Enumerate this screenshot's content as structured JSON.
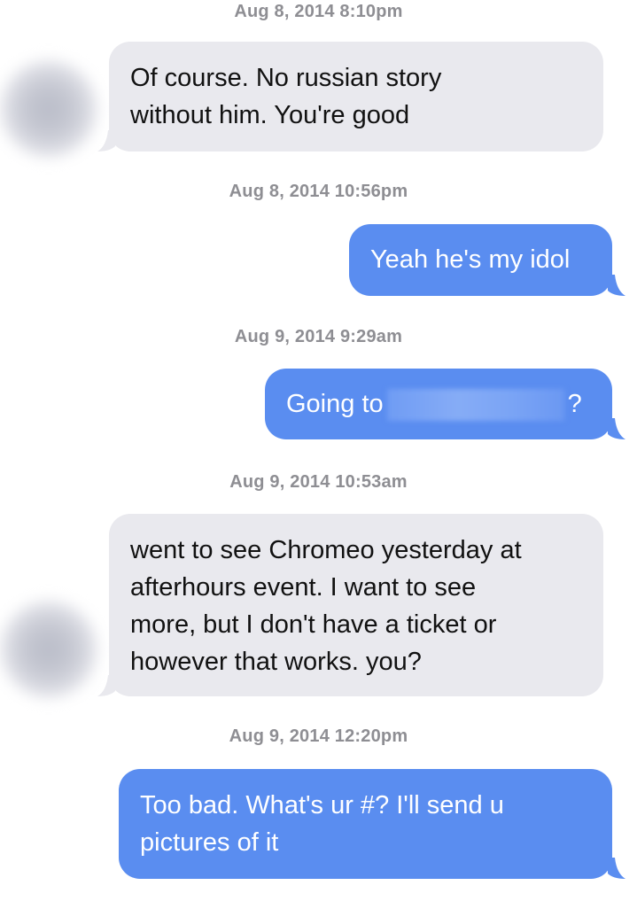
{
  "messages": [
    {
      "timestamp": "Aug 8, 2014 8:10pm",
      "direction": "received",
      "lines": [
        "Of course. No russian story",
        "without him. You're good"
      ]
    },
    {
      "timestamp": "Aug 8, 2014 10:56pm",
      "direction": "sent",
      "lines": [
        "Yeah he's my idol"
      ]
    },
    {
      "timestamp": "Aug 9, 2014 9:29am",
      "direction": "sent",
      "prefix": "Going to",
      "suffix": "?"
    },
    {
      "timestamp": "Aug 9, 2014 10:53am",
      "direction": "received",
      "lines": [
        "went to see Chromeo yesterday at",
        "afterhours event. I want to see",
        "more, but I don't have a ticket or",
        "however that works. you?"
      ]
    },
    {
      "timestamp": "Aug 9, 2014 12:20pm",
      "direction": "sent",
      "lines": [
        "Too bad. What's ur #? I'll send u",
        "pictures of it"
      ]
    }
  ],
  "colors": {
    "sent_bubble": "#5a8df0",
    "received_bubble": "#e9e9ee",
    "timestamp_text": "#8e8e93"
  }
}
